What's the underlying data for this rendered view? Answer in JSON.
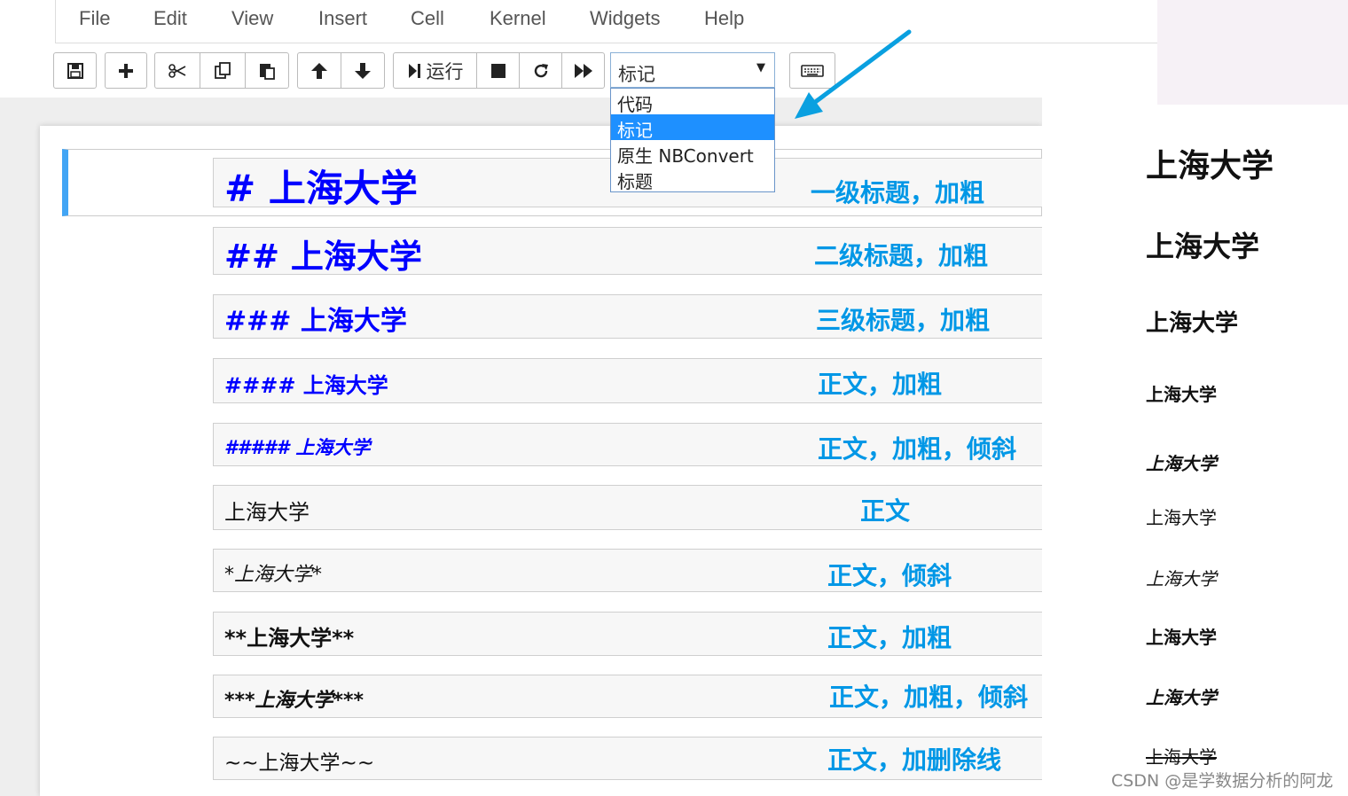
{
  "menu": [
    "File",
    "Edit",
    "View",
    "Insert",
    "Cell",
    "Kernel",
    "Widgets",
    "Help"
  ],
  "toolbar": {
    "run_label": "运行",
    "cell_type_selected": "标记",
    "icons": [
      "save-icon",
      "plus-icon",
      "cut-icon",
      "copy-icon",
      "paste-icon",
      "arrow-up-icon",
      "arrow-down-icon",
      "run-icon",
      "stop-icon",
      "restart-icon",
      "fast-forward-icon",
      "keyboard-icon"
    ]
  },
  "dropdown": {
    "options": [
      "代码",
      "标记",
      "原生 NBConvert",
      "标题"
    ],
    "selected_index": 1
  },
  "cells": [
    {
      "source": "# 上海大学",
      "note": "一级标题，加粗"
    },
    {
      "source": "## 上海大学",
      "note": "二级标题，加粗"
    },
    {
      "source": "### 上海大学",
      "note": "三级标题，加粗"
    },
    {
      "source": "#### 上海大学",
      "note": "正文，加粗"
    },
    {
      "source": "##### 上海大学",
      "note": "正文，加粗，倾斜"
    },
    {
      "source": "上海大学",
      "note": "正文"
    },
    {
      "source": "*上海大学*",
      "note": "正文，倾斜"
    },
    {
      "source": "**上海大学**",
      "note": "正文，加粗"
    },
    {
      "source": "***上海大学***",
      "note": "正文，加粗，倾斜"
    },
    {
      "source": "~~上海大学~~",
      "note": "正文，加删除线"
    }
  ],
  "rendered": [
    "上海大学",
    "上海大学",
    "上海大学",
    "上海大学",
    "上海大学",
    "上海大学",
    "上海大学",
    "上海大学",
    "上海大学",
    "上海大学"
  ],
  "watermark": "CSDN @是学数据分析的阿龙",
  "colors": {
    "accent_blue": "#0000ff",
    "note_cyan": "#0097e6",
    "selection": "#1e90ff",
    "arrow": "#0aa0e0"
  }
}
